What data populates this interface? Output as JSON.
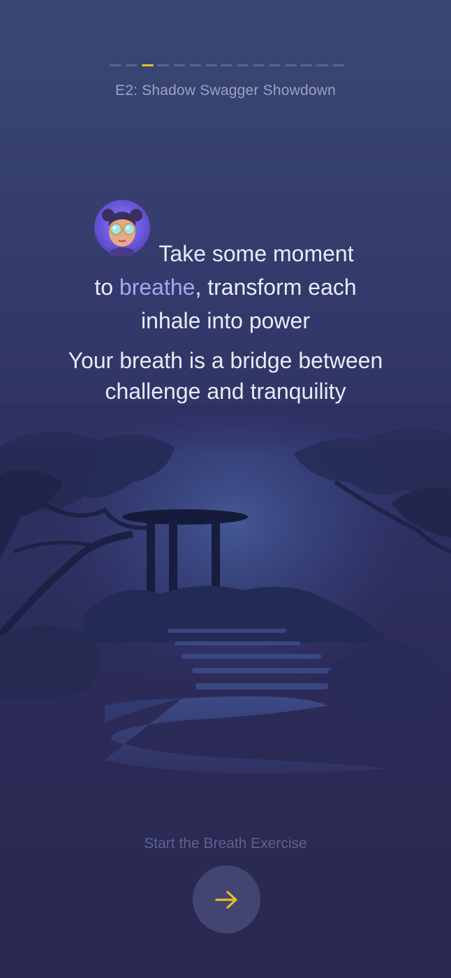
{
  "progress": {
    "total_steps": 15,
    "current_step": 3
  },
  "header": {
    "episode_title": "E2: Shadow Swagger Showdown"
  },
  "message": {
    "line1_part1": "Take some moment",
    "line2_prefix": "to ",
    "highlight_word": "breathe",
    "line2_suffix": ", transform each",
    "line3": "inhale into power",
    "secondary_line1": "Your breath is a bridge between",
    "secondary_line2": "challenge and tranquility"
  },
  "cta": {
    "label": "Start the Breath Exercise",
    "button_icon": "arrow-right-icon"
  },
  "colors": {
    "accent_word": "#a6a8ec",
    "progress_active": "#e8bf2e",
    "arrow": "#e8bf2e",
    "button_bg": "#424571"
  }
}
